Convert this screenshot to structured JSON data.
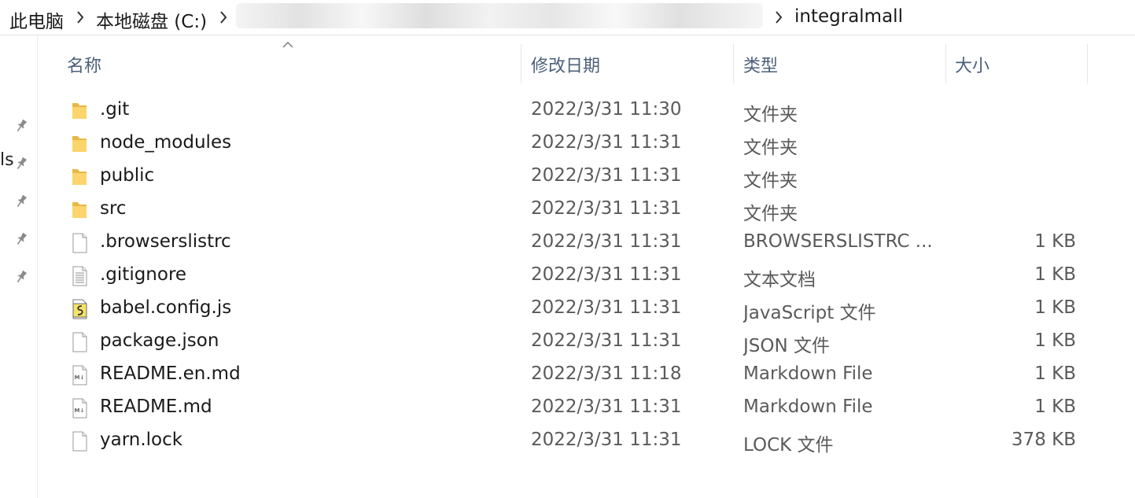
{
  "breadcrumb": {
    "items": [
      "此电脑",
      "本地磁盘 (C:)",
      "integralmall"
    ]
  },
  "nav": {
    "partial_label": "ls"
  },
  "columns": {
    "name": "名称",
    "modified": "修改日期",
    "type": "类型",
    "size": "大小"
  },
  "files": [
    {
      "name": ".git",
      "date": "2022/3/31 11:30",
      "type": "文件夹",
      "size": "",
      "icon": "folder-icon"
    },
    {
      "name": "node_modules",
      "date": "2022/3/31 11:31",
      "type": "文件夹",
      "size": "",
      "icon": "folder-icon"
    },
    {
      "name": "public",
      "date": "2022/3/31 11:31",
      "type": "文件夹",
      "size": "",
      "icon": "folder-icon"
    },
    {
      "name": "src",
      "date": "2022/3/31 11:31",
      "type": "文件夹",
      "size": "",
      "icon": "folder-icon"
    },
    {
      "name": ".browserslistrc",
      "date": "2022/3/31 11:31",
      "type": "BROWSERSLISTRC ...",
      "size": "1 KB",
      "icon": "file-icon"
    },
    {
      "name": ".gitignore",
      "date": "2022/3/31 11:31",
      "type": "文本文档",
      "size": "1 KB",
      "icon": "text-file-icon"
    },
    {
      "name": "babel.config.js",
      "date": "2022/3/31 11:31",
      "type": "JavaScript 文件",
      "size": "1 KB",
      "icon": "script-file-icon"
    },
    {
      "name": "package.json",
      "date": "2022/3/31 11:31",
      "type": "JSON 文件",
      "size": "1 KB",
      "icon": "file-icon"
    },
    {
      "name": "README.en.md",
      "date": "2022/3/31 11:18",
      "type": "Markdown File",
      "size": "1 KB",
      "icon": "markdown-file-icon"
    },
    {
      "name": "README.md",
      "date": "2022/3/31 11:31",
      "type": "Markdown File",
      "size": "1 KB",
      "icon": "markdown-file-icon"
    },
    {
      "name": "yarn.lock",
      "date": "2022/3/31 11:31",
      "type": "LOCK 文件",
      "size": "378 KB",
      "icon": "file-icon"
    }
  ]
}
